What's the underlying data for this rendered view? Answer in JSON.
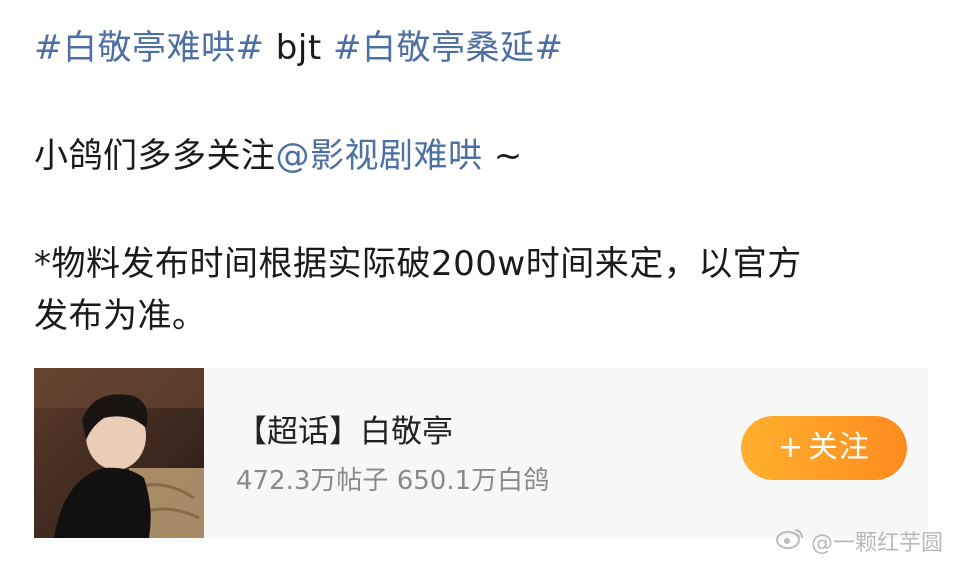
{
  "post": {
    "line1": {
      "tag1": "#白敬亭难哄#",
      "plain": " bjt ",
      "tag2": "#白敬亭桑延#"
    },
    "line2": {
      "prefix": "小鸽们多多关注",
      "mention": "@影视剧难哄",
      "suffix": " ~"
    },
    "line3": "*物料发布时间根据实际破200w时间来定，以官方",
    "line4": "发布为准。"
  },
  "card": {
    "title": "【超话】白敬亭",
    "stats": "472.3万帖子 650.1万白鸽",
    "follow_label": "关注",
    "follow_plus": "+",
    "thumbnail_icon": "profile-photo"
  },
  "watermark": {
    "text": "@一颗红芋圆",
    "icon": "weibo-logo-icon"
  },
  "colors": {
    "link": "#4d6fa3",
    "button": "#ff9a26",
    "card_bg": "#f7f7f7"
  }
}
